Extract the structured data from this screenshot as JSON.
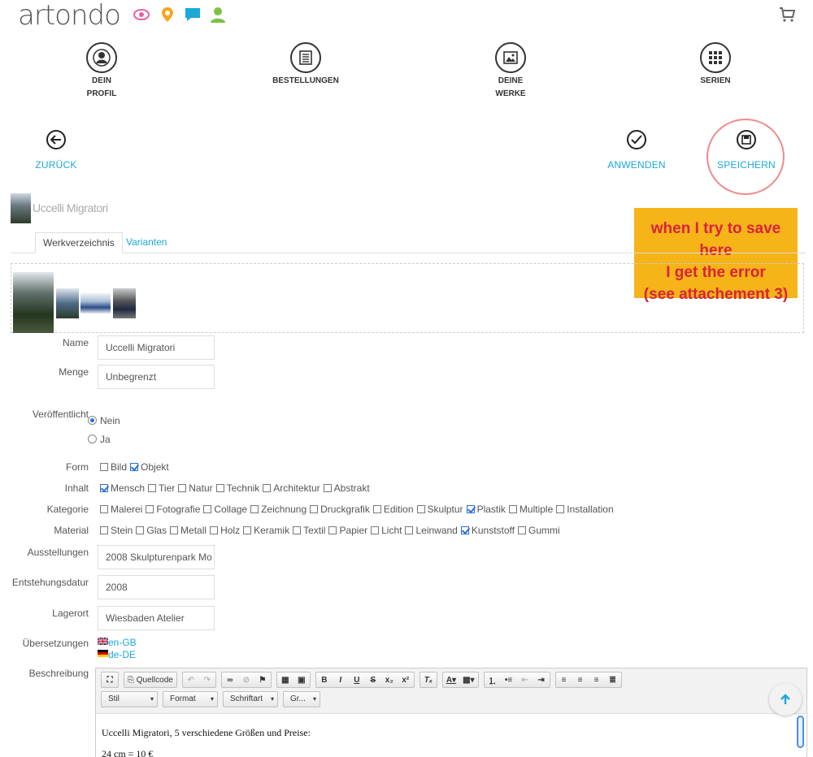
{
  "header": {
    "logo": "artondo",
    "icons": [
      "eye-icon",
      "location-pin-icon",
      "chat-icon",
      "user-icon"
    ],
    "cart_icon": "cart-icon"
  },
  "topnav": [
    {
      "line1": "DEIN",
      "line2": "PROFIL",
      "icon": "profile-icon"
    },
    {
      "line1": "BESTELLUNGEN",
      "line2": "",
      "icon": "orders-icon"
    },
    {
      "line1": "DEINE",
      "line2": "WERKE",
      "icon": "works-icon"
    },
    {
      "line1": "SERIEN",
      "line2": "",
      "icon": "series-icon"
    }
  ],
  "actions": {
    "back": "ZURÜCK",
    "apply": "ANWENDEN",
    "save": "SPEICHERN"
  },
  "title": "Uccelli Migratori",
  "annotation": {
    "line1": "when I try to save here",
    "line2": "I get the error",
    "line3": "(see attachement 3)"
  },
  "tabs": {
    "active": "Werkverzeichnis",
    "inactive": "Varianten"
  },
  "form": {
    "name_label": "Name",
    "name_value": "Uccelli Migratori",
    "menge_label": "Menge",
    "menge_value": "Unbegrenzt",
    "published_label": "Veröffentlicht",
    "published_options": [
      "Nein",
      "Ja"
    ],
    "published_selected": "Nein",
    "form_label": "Form",
    "form_options": [
      {
        "label": "Bild",
        "checked": false
      },
      {
        "label": "Objekt",
        "checked": true
      }
    ],
    "inhalt_label": "Inhalt",
    "inhalt_options": [
      {
        "label": "Mensch",
        "checked": true
      },
      {
        "label": "Tier",
        "checked": false
      },
      {
        "label": "Natur",
        "checked": false
      },
      {
        "label": "Technik",
        "checked": false
      },
      {
        "label": "Architektur",
        "checked": false
      },
      {
        "label": "Abstrakt",
        "checked": false
      }
    ],
    "kategorie_label": "Kategorie",
    "kategorie_options": [
      {
        "label": "Malerei",
        "checked": false
      },
      {
        "label": "Fotografie",
        "checked": false
      },
      {
        "label": "Collage",
        "checked": false
      },
      {
        "label": "Zeichnung",
        "checked": false
      },
      {
        "label": "Druckgrafik",
        "checked": false
      },
      {
        "label": "Edition",
        "checked": false
      },
      {
        "label": "Skulptur",
        "checked": false
      },
      {
        "label": "Plastik",
        "checked": true
      },
      {
        "label": "Multiple",
        "checked": false
      },
      {
        "label": "Installation",
        "checked": false
      }
    ],
    "material_label": "Material",
    "material_options": [
      {
        "label": "Stein",
        "checked": false
      },
      {
        "label": "Glas",
        "checked": false
      },
      {
        "label": "Metall",
        "checked": false
      },
      {
        "label": "Holz",
        "checked": false
      },
      {
        "label": "Keramik",
        "checked": false
      },
      {
        "label": "Textil",
        "checked": false
      },
      {
        "label": "Papier",
        "checked": false
      },
      {
        "label": "Licht",
        "checked": false
      },
      {
        "label": "Leinwand",
        "checked": false
      },
      {
        "label": "Kunststoff",
        "checked": true
      },
      {
        "label": "Gummi",
        "checked": false
      }
    ],
    "ausstellungen_label": "Ausstellungen",
    "ausstellungen_value": "2008 Skulpturenpark Mo",
    "entstehung_label": "Entstehungsdatur",
    "entstehung_value": "2008",
    "lagerort_label": "Lagerort",
    "lagerort_value": "Wiesbaden Atelier",
    "uebersetzungen_label": "Übersetzungen",
    "translations": [
      "en-GB",
      "de-DE"
    ],
    "beschreibung_label": "Beschreibung"
  },
  "editor": {
    "source_label": "Quellcode",
    "dropdowns": [
      "Stil",
      "Format",
      "Schriftart",
      "Gr..."
    ],
    "line1": "Uccelli Migratori, 5 verschiedene Größen und Preise:",
    "line2": "24 cm = 10 €"
  },
  "colors": {
    "accent": "#1aa9d9",
    "annotation_bg": "#f6b418",
    "annotation_text": "#d8233a",
    "ring": "#f08a8a"
  }
}
